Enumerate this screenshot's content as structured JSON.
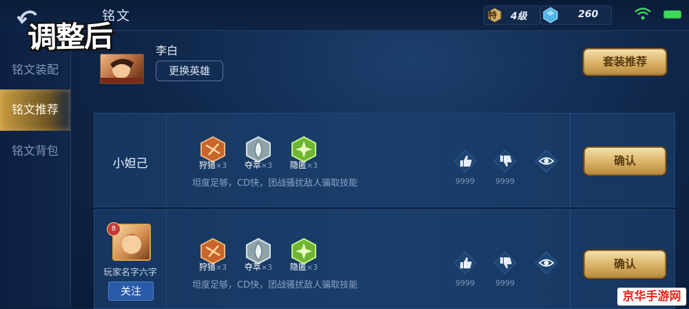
{
  "header": {
    "title": "铭文",
    "level_badge": "特",
    "level_text": "4级",
    "gem_count": "260"
  },
  "stamp_text": "调整后",
  "sidebar": {
    "items": [
      {
        "label": "铭文装配",
        "active": false
      },
      {
        "label": "铭文推荐",
        "active": true
      },
      {
        "label": "铭文背包",
        "active": false
      }
    ]
  },
  "hero": {
    "name": "李白",
    "change_button": "更换英雄",
    "set_recommend_button": "套装推荐"
  },
  "cards": [
    {
      "author": "小妲己",
      "runes": [
        {
          "name": "狩猎",
          "count": "×3",
          "color": "#d2702a"
        },
        {
          "name": "夺萃",
          "count": "×3",
          "color": "#9fb3b9"
        },
        {
          "name": "隐匿",
          "count": "×3",
          "color": "#7cc23c"
        }
      ],
      "description": "坦度足够，CD快，团战骚扰敌人骗取技能",
      "likes": "9999",
      "dislikes": "9999",
      "confirm_button": "确认"
    },
    {
      "author": "玩家名字六字",
      "avatar_badge": "8",
      "follow_button": "关注",
      "runes": [
        {
          "name": "狩猎",
          "count": "×3",
          "color": "#d2702a"
        },
        {
          "name": "夺萃",
          "count": "×3",
          "color": "#9fb3b9"
        },
        {
          "name": "隐匿",
          "count": "×3",
          "color": "#7cc23c"
        }
      ],
      "description": "坦度足够，CD快，团战骚扰敌人骗取技能",
      "likes": "9999",
      "dislikes": "9999",
      "confirm_button": "确认"
    }
  ],
  "watermark": "京华手游网",
  "colors": {
    "accent_gold": "#d6ad62",
    "active_tab": "#c89b3e",
    "follow_blue": "#2a5aa8",
    "battery_green": "#3fd85a"
  }
}
